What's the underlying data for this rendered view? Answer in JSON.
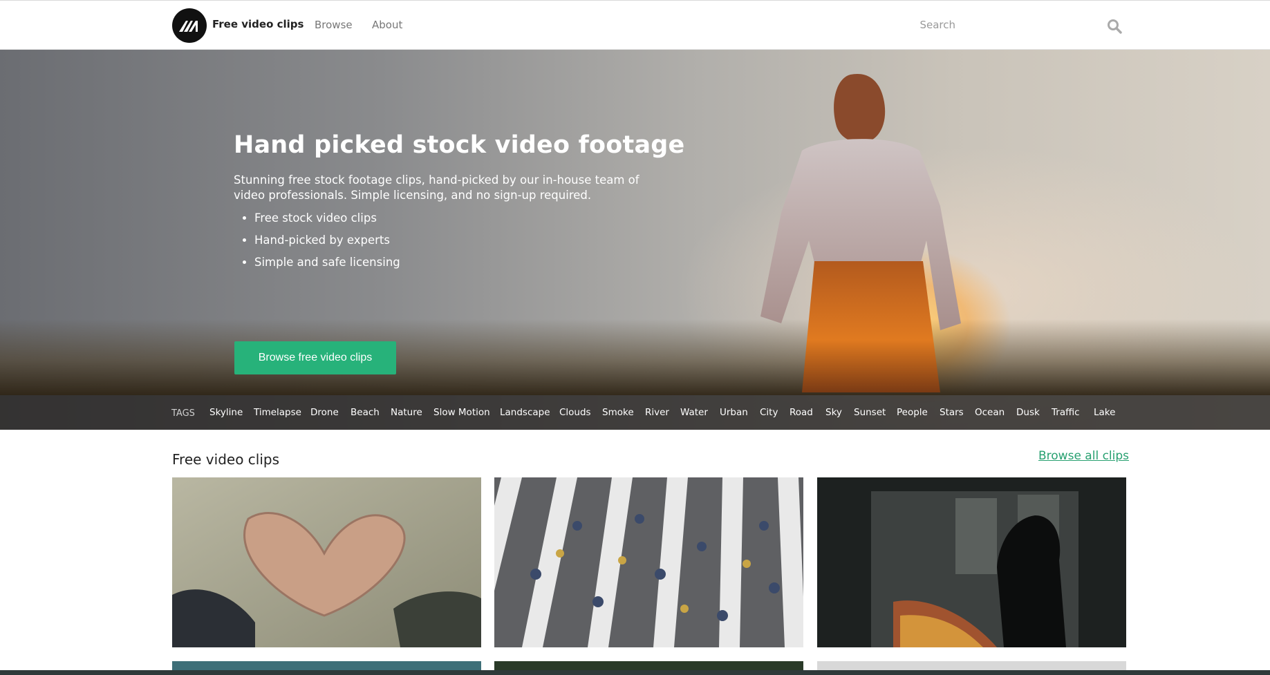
{
  "nav": {
    "brand": "Free video clips",
    "links": [
      "Browse",
      "About"
    ],
    "search_label": "Search"
  },
  "hero": {
    "title": "Hand picked stock video footage",
    "description": "Stunning free stock footage clips, hand-picked by our in-house team of video professionals. Simple licensing, and no sign-up required.",
    "bullets": [
      "Free stock video clips",
      "Hand-picked by experts",
      "Simple and safe licensing"
    ],
    "cta": "Browse free video clips",
    "cta_color": "#27b27a"
  },
  "tags": {
    "label": "TAGS",
    "items": [
      "Skyline",
      "Timelapse",
      "Drone",
      "Beach",
      "Nature",
      "Slow Motion",
      "Landscape",
      "Clouds",
      "Smoke",
      "River",
      "Water",
      "Urban",
      "City",
      "Road",
      "Sky",
      "Sunset",
      "People",
      "Stars",
      "Ocean",
      "Dusk",
      "Traffic",
      "Lake"
    ]
  },
  "section": {
    "title": "Free video clips",
    "browse_all": "Browse all clips",
    "link_color": "#27a070"
  },
  "clips": [
    {
      "subject": "hands-heart"
    },
    {
      "subject": "crosswalk-crowd"
    },
    {
      "subject": "city-window-silhouette"
    }
  ]
}
